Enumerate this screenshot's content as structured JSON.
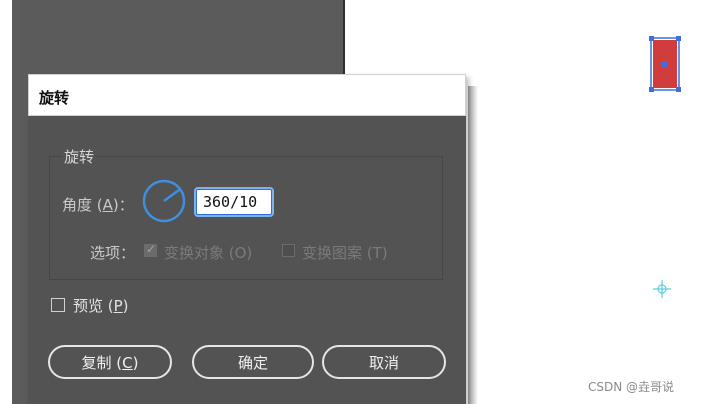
{
  "dialog": {
    "title": "旋转",
    "group_title": "旋转",
    "angle_label_prefix": "角度 (",
    "angle_label_key": "A",
    "angle_label_suffix": ")：",
    "angle_value": "360/10",
    "options_label": "选项：",
    "option_transform_objects": "变换对象 (O)",
    "option_transform_objects_checked": true,
    "option_transform_pattern": "变换图案 (T)",
    "option_transform_pattern_checked": false,
    "preview_label_prefix": "预览 (",
    "preview_key": "P",
    "preview_label_suffix": ")",
    "preview_checked": false,
    "buttons": {
      "copy_prefix": "复制 (",
      "copy_key": "C",
      "copy_suffix": ")",
      "ok": "确定",
      "cancel": "取消"
    }
  },
  "canvas": {
    "shape_fill_color": "#d13d3d",
    "shape_selection_color": "#3f6fd8",
    "crosshair_color": "#5ad0d8"
  },
  "watermark": "CSDN @垚哥说",
  "colors": {
    "dialog_bg": "#535353",
    "accent_blue": "#3f8fde"
  }
}
